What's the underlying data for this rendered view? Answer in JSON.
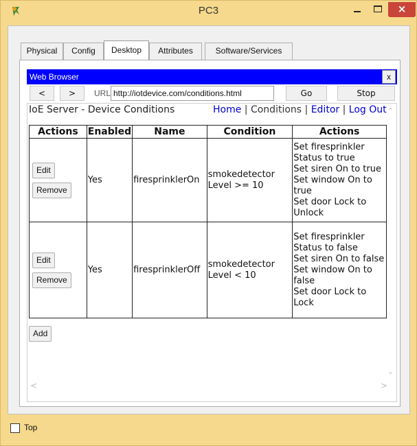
{
  "window": {
    "title": "PC3",
    "minimize_icon": "minimize-icon",
    "maximize_icon": "maximize-icon",
    "close_label": "×"
  },
  "tabs": [
    "Physical",
    "Config",
    "Desktop",
    "Attributes",
    "Software/Services"
  ],
  "active_tab": "Desktop",
  "browser": {
    "title": "Web Browser",
    "close_label": "x",
    "back_label": "<",
    "forward_label": ">",
    "url_label": "URL",
    "url": "http://iotdevice.com/conditions.html",
    "go_label": "Go",
    "stop_label": "Stop"
  },
  "page": {
    "heading": "IoE Server - Device Conditions",
    "nav": {
      "home": "Home",
      "sep1": " | ",
      "conditions": "Conditions",
      "sep2": " | ",
      "editor": "Editor",
      "sep3": " | ",
      "logout": "Log Out"
    },
    "table": {
      "headers": [
        "Actions",
        "Enabled",
        "Name",
        "Condition",
        "Actions"
      ],
      "rows": [
        {
          "edit_label": "Edit",
          "remove_label": "Remove",
          "enabled": "Yes",
          "name": "firesprinklerOn",
          "condition_line1": "smokedetector",
          "condition_line2": "Level >= 10",
          "actions": [
            "Set firesprinkler Status to true",
            "Set siren On to true",
            "Set window On to true",
            "Set door Lock to Unlock"
          ]
        },
        {
          "edit_label": "Edit",
          "remove_label": "Remove",
          "enabled": "Yes",
          "name": "firesprinklerOff",
          "condition_line1": "smokedetector",
          "condition_line2": "Level < 10",
          "actions": [
            "Set firesprinkler Status to false",
            "Set siren On to false",
            "Set window On to false",
            "Set door Lock to Lock"
          ]
        }
      ]
    },
    "add_label": "Add"
  },
  "footer": {
    "top_label": "Top",
    "top_checked": false
  },
  "colors": {
    "window_frame": "#f6d98c",
    "browser_header": "#0000ff",
    "link": "#0000cc",
    "close_button": "#c9453a"
  }
}
